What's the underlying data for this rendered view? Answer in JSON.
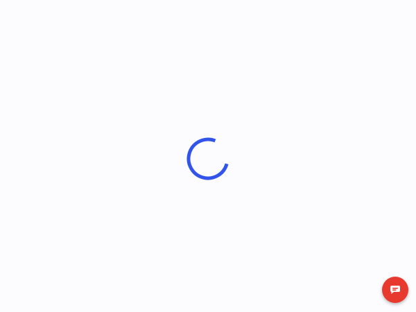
{
  "loading": {
    "icon": "loading-spinner-icon",
    "color": "#3354e8"
  },
  "chat_widget": {
    "icon": "chat-bubble-icon",
    "color": "#e8392e"
  }
}
